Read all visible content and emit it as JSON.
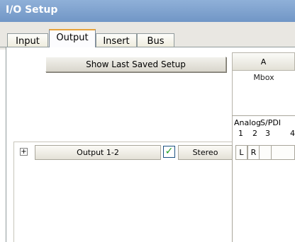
{
  "window": {
    "title": "I/O Setup"
  },
  "tabs": [
    {
      "label": "Input",
      "active": false
    },
    {
      "label": "Output",
      "active": true
    },
    {
      "label": "Insert",
      "active": false
    },
    {
      "label": "Bus",
      "active": false
    }
  ],
  "toolbar": {
    "show_saved_label": "Show Last Saved Setup"
  },
  "device": {
    "column_label": "A",
    "name": "Mbox",
    "channel_groups": [
      "Analog",
      "S/PDI"
    ],
    "channel_numbers": [
      "1",
      "2",
      "3",
      "4"
    ]
  },
  "path": {
    "expand_glyph": "+",
    "name": "Output 1-2",
    "enabled": true,
    "check_glyph": "✓",
    "format": "Stereo",
    "left_label": "L",
    "right_label": "R"
  },
  "colors": {
    "titlebar": "#7f9fcf",
    "accent_tab": "#e6a23c",
    "check": "#21a121"
  }
}
